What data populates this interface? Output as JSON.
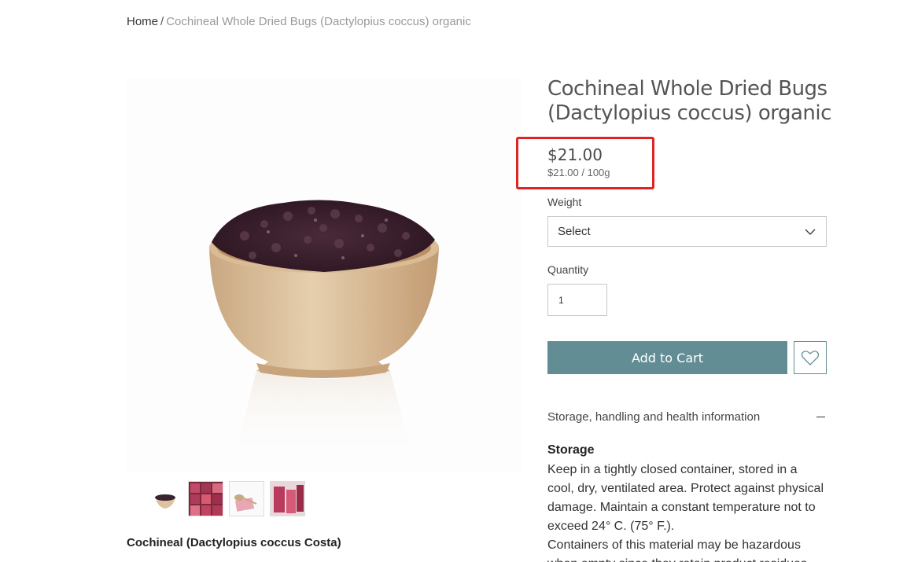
{
  "breadcrumb": {
    "home": "Home",
    "separator": "/",
    "current": "Cochineal Whole Dried Bugs (Dactylopius coccus) organic"
  },
  "product": {
    "title": "Cochineal Whole Dried Bugs (Dactylopius coccus) organic",
    "price": "$21.00",
    "unit_price": "$21.00 / 100g",
    "description_title": "Cochineal (Dactylopius coccus Costa)"
  },
  "options": {
    "weight_label": "Weight",
    "weight_value": "Select",
    "quantity_label": "Quantity",
    "quantity_value": "1"
  },
  "actions": {
    "add_to_cart": "Add to Cart"
  },
  "info": {
    "accordion_title": "Storage, handling and health information",
    "storage_title": "Storage",
    "storage_text": "Keep in a tightly closed container, stored in a cool, dry, ventilated area. Protect against physical damage. Maintain a constant temperature not to exceed 24° C. (75° F.).\n Containers of this material may be hazardous when empty since they retain product residues"
  },
  "colors": {
    "accent": "#638d94",
    "highlight_box": "#e02424"
  },
  "icons": [
    "chevron-down-icon",
    "heart-icon",
    "minus-icon"
  ]
}
